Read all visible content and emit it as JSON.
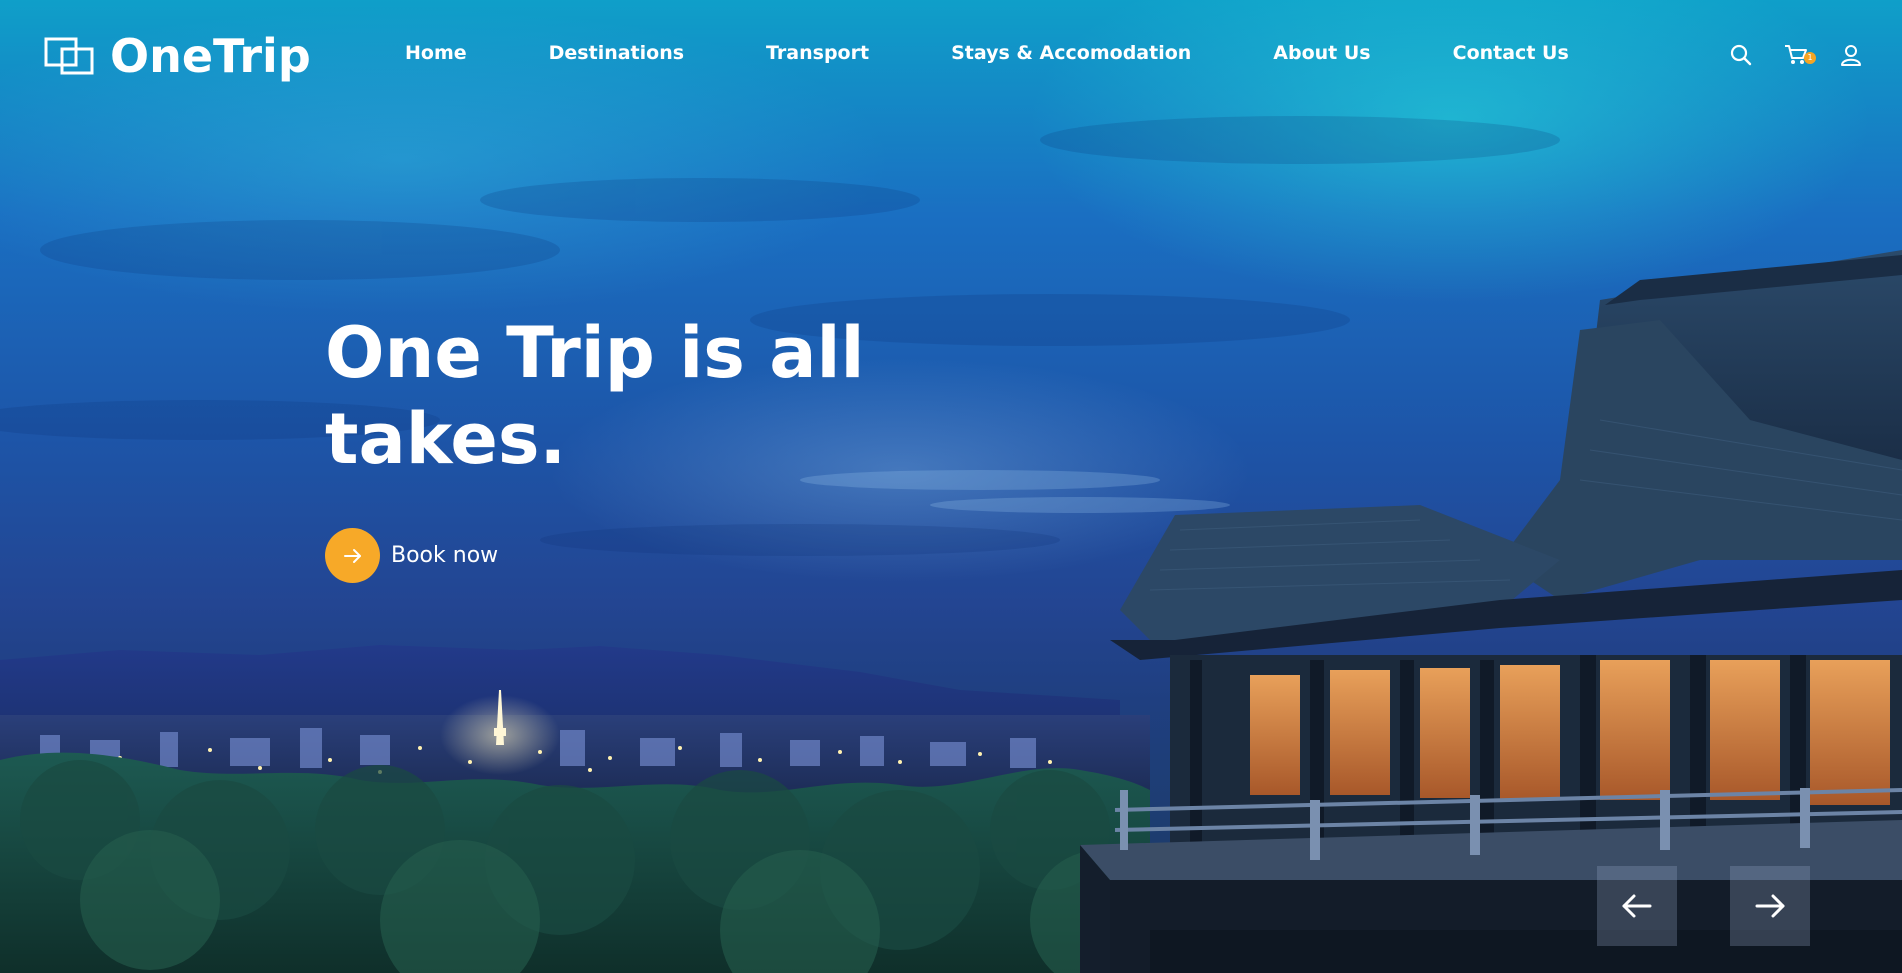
{
  "brand": {
    "name": "OneTrip",
    "logo_icon": "overlapping-squares-logo-icon"
  },
  "nav": {
    "items": [
      {
        "label": "Home"
      },
      {
        "label": "Destinations"
      },
      {
        "label": "Transport"
      },
      {
        "label": "Stays & Accomodation"
      },
      {
        "label": "About Us"
      },
      {
        "label": "Contact Us"
      }
    ]
  },
  "header_actions": {
    "search_icon": "search-icon",
    "cart_icon": "cart-icon",
    "cart_count": "1",
    "user_icon": "user-icon"
  },
  "hero": {
    "title": "One Trip is all takes.",
    "cta_label": "Book now",
    "cta_icon": "arrow-right-icon",
    "background": "night view of a wooden temple terrace overlooking a lit city and mountains"
  },
  "slider": {
    "prev_icon": "arrow-left-icon",
    "next_icon": "arrow-right-icon"
  },
  "colors": {
    "accent": "#f7a928",
    "text": "#ffffff",
    "sky_top": "#0f9fc9",
    "sky_mid": "#1d55a8"
  }
}
